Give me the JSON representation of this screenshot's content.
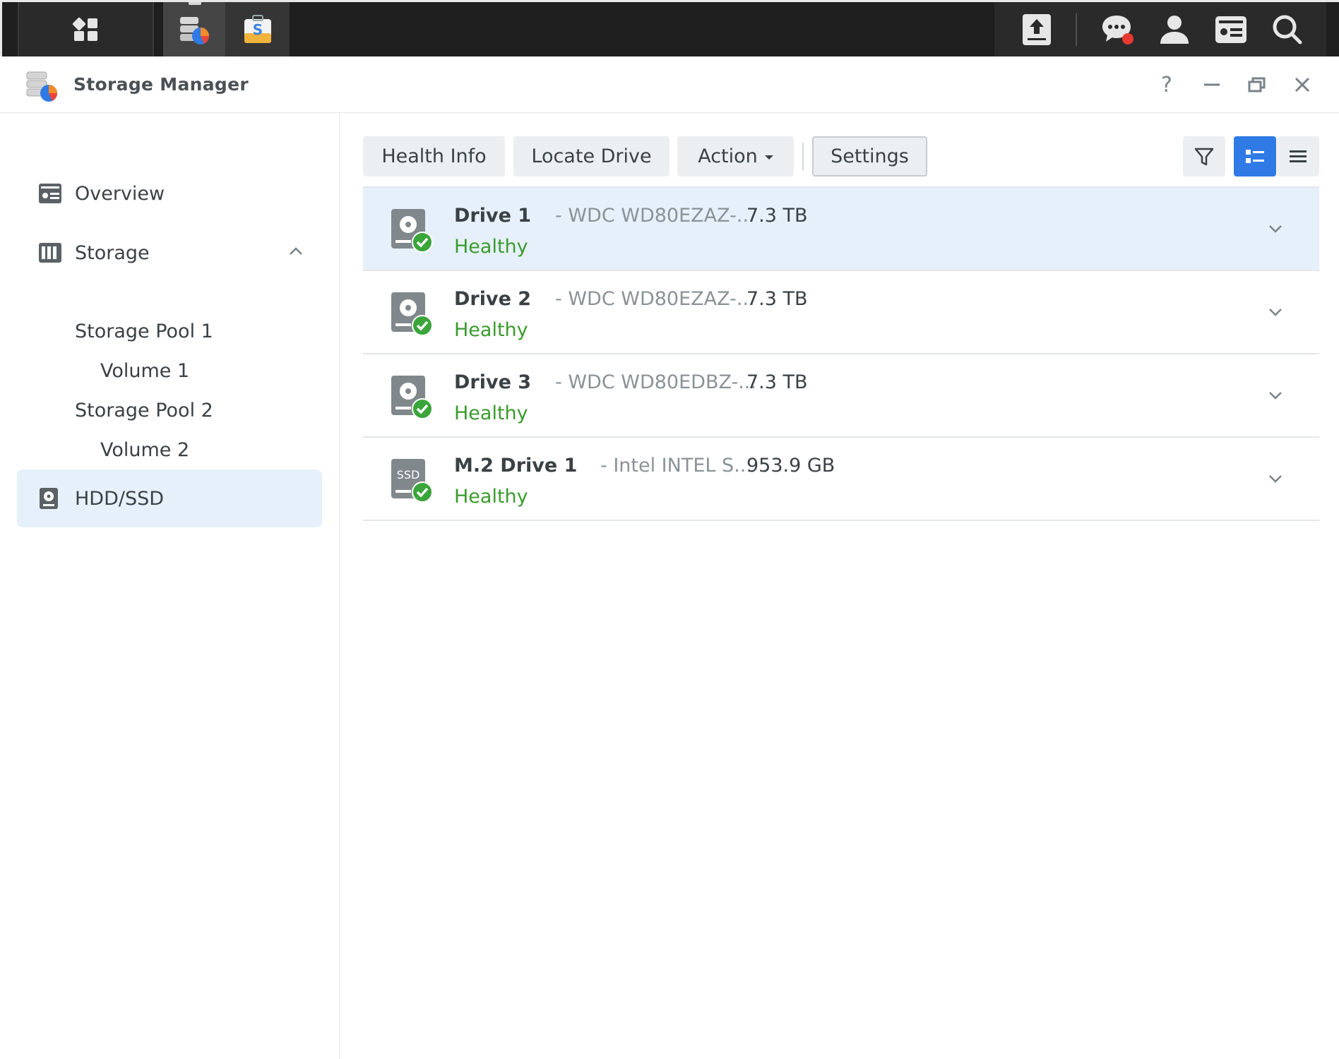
{
  "taskbar": {
    "icons": [
      "main-menu-icon",
      "storage-manager-app-icon",
      "package-center-app-icon",
      "upload-icon",
      "chat-icon",
      "user-icon",
      "widgets-icon",
      "search-icon"
    ]
  },
  "window": {
    "title": "Storage Manager",
    "controls": {
      "help": "?"
    }
  },
  "sidebar": {
    "overview": "Overview",
    "storage": "Storage",
    "pool1": "Storage Pool 1",
    "volume1": "Volume 1",
    "pool2": "Storage Pool 2",
    "volume2": "Volume 2",
    "hdd": "HDD/SSD"
  },
  "toolbar": {
    "health_info": "Health Info",
    "locate_drive": "Locate Drive",
    "action": "Action",
    "settings": "Settings"
  },
  "drives": [
    {
      "name": "Drive 1",
      "model": "- WDC WD80EZAZ-...",
      "capacity": "7.3 TB",
      "status": "Healthy",
      "type": "HDD"
    },
    {
      "name": "Drive 2",
      "model": "- WDC WD80EZAZ-...",
      "capacity": "7.3 TB",
      "status": "Healthy",
      "type": "HDD"
    },
    {
      "name": "Drive 3",
      "model": "- WDC WD80EDBZ-...",
      "capacity": "7.3 TB",
      "status": "Healthy",
      "type": "HDD"
    },
    {
      "name": "M.2 Drive 1",
      "model": "- Intel INTEL S...",
      "capacity": "953.9 GB",
      "status": "Healthy",
      "type": "SSD"
    }
  ],
  "colors": {
    "accent": "#2f7ae5",
    "healthy": "#3a9b2c",
    "selected_bg": "#e6f0fb"
  }
}
